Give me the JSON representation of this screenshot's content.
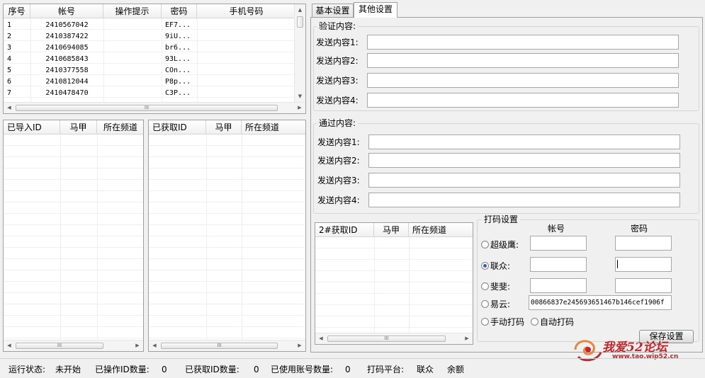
{
  "account_table": {
    "headers": [
      "序号",
      "帐号",
      "操作提示",
      "密码",
      "手机号码"
    ],
    "rows": [
      [
        "1",
        "2410567042",
        "",
        "EF7...",
        ""
      ],
      [
        "2",
        "2410387422",
        "",
        "9iU...",
        ""
      ],
      [
        "3",
        "2410694085",
        "",
        "br6...",
        ""
      ],
      [
        "4",
        "2410685843",
        "",
        "93L...",
        ""
      ],
      [
        "5",
        "2410377558",
        "",
        "COn...",
        ""
      ],
      [
        "6",
        "2410812044",
        "",
        "P8p...",
        ""
      ],
      [
        "7",
        "2410478470",
        "",
        "C3P...",
        ""
      ]
    ]
  },
  "imported_list": {
    "headers": [
      "已导入ID",
      "马甲",
      "所在频道"
    ]
  },
  "fetched_list": {
    "headers": [
      "已获取ID",
      "马甲",
      "所在频道"
    ]
  },
  "fetched2_list": {
    "headers": [
      "2#获取ID",
      "马甲",
      "所在频道"
    ]
  },
  "scroll_grip": "III",
  "tabs": [
    "基本设置",
    "其他设置"
  ],
  "verify": {
    "title": "验证内容:",
    "labels": [
      "发送内容1:",
      "发送内容2:",
      "发送内容3:",
      "发送内容4:"
    ]
  },
  "pass": {
    "title": "通过内容:",
    "labels": [
      "发送内容1:",
      "发送内容2:",
      "发送内容3:",
      "发送内容4:"
    ]
  },
  "captcha": {
    "title": "打码设置",
    "col_account": "帐号",
    "col_password": "密码",
    "options": [
      "超级鹰:",
      "联众:",
      "斐斐:",
      "易云:"
    ],
    "selected": "联众:",
    "yiyun_value": "00866837e245693651467b146cef1906f",
    "manual": "手动打码",
    "auto": "自动打码"
  },
  "save_button": "保存设置",
  "status": {
    "run_label": "运行状态:",
    "run_value": "未开始",
    "ops_label": "已操作ID数量:",
    "ops_value": "0",
    "fetched_label": "已获取ID数量:",
    "fetched_value": "0",
    "used_label": "已使用账号数量:",
    "used_value": "0",
    "platform_label": "打码平台:",
    "platform_value": "联众",
    "balance_label": "余额"
  },
  "watermark": {
    "text": "我爱52论坛",
    "url": "www.tao.wip52.cn"
  },
  "colors": {
    "radio_selected": "#2a5fcc",
    "watermark": "#c2272d"
  }
}
